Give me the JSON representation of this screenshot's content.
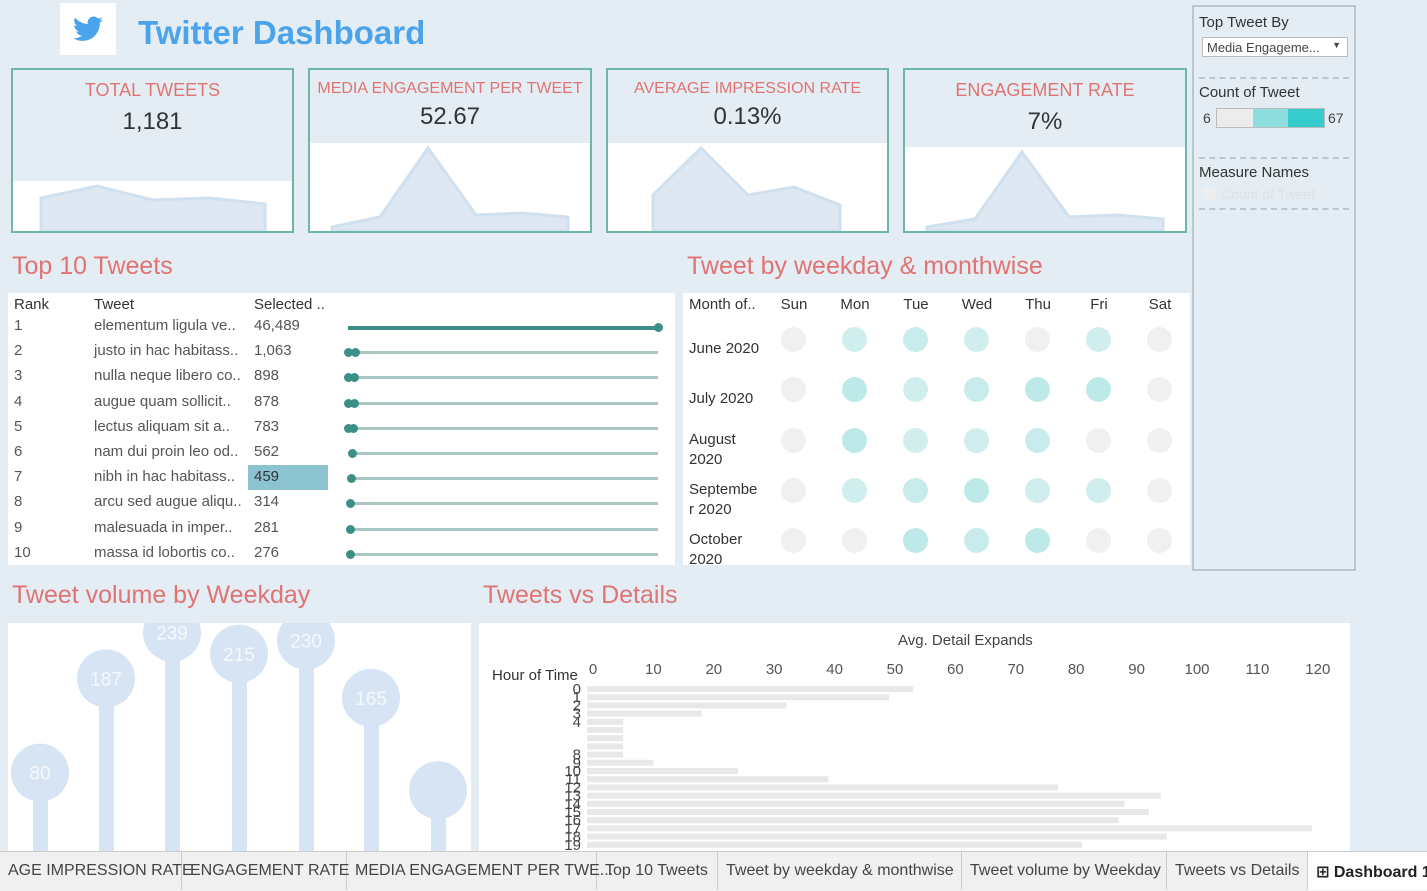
{
  "header": {
    "title": "Twitter Dashboard",
    "logo_icon": "twitter-bird-icon"
  },
  "kpis": [
    {
      "label": "TOTAL TWEETS",
      "value": "1,181"
    },
    {
      "label": "MEDIA ENGAGEMENT PER TWEET",
      "value": "52.67"
    },
    {
      "label": "AVERAGE IMPRESSION RATE",
      "value": "0.13%"
    },
    {
      "label": "ENGAGEMENT RATE",
      "value": "7%"
    }
  ],
  "top10": {
    "title": "Top 10 Tweets",
    "headers": [
      "Rank",
      "Tweet",
      "Selected .."
    ],
    "rows": [
      {
        "rank": "1",
        "tweet": "elementum ligula ve..",
        "value": "46,489",
        "frac": 1.0
      },
      {
        "rank": "2",
        "tweet": "justo in hac habitass..",
        "value": "1,063",
        "frac": 0.023
      },
      {
        "rank": "3",
        "tweet": "nulla neque libero co..",
        "value": "898",
        "frac": 0.019
      },
      {
        "rank": "4",
        "tweet": "augue quam sollicit..",
        "value": "878",
        "frac": 0.019
      },
      {
        "rank": "5",
        "tweet": "lectus aliquam sit a..",
        "value": "783",
        "frac": 0.017
      },
      {
        "rank": "6",
        "tweet": "nam dui proin leo od..",
        "value": "562",
        "frac": 0.012
      },
      {
        "rank": "7",
        "tweet": "nibh in hac habitass..",
        "value": "459",
        "frac": 0.01,
        "selected": true
      },
      {
        "rank": "8",
        "tweet": "arcu sed augue aliqu..",
        "value": "314",
        "frac": 0.007
      },
      {
        "rank": "9",
        "tweet": "malesuada in imper..",
        "value": "281",
        "frac": 0.006
      },
      {
        "rank": "10",
        "tweet": "massa id lobortis co..",
        "value": "276",
        "frac": 0.006
      }
    ]
  },
  "weekday_month": {
    "title": "Tweet by weekday & monthwise",
    "row_header": "Month of..",
    "days": [
      "Sun",
      "Mon",
      "Tue",
      "Wed",
      "Thu",
      "Fri",
      "Sat"
    ],
    "months": [
      "June 2020",
      "July 2020",
      "August 2020",
      "September 2020",
      "October 2020"
    ],
    "month_display": [
      "June 2020",
      "July 2020",
      "August\n2020",
      "Septembe\nr 2020",
      "October\n2020"
    ],
    "intensity": [
      [
        0,
        2,
        3,
        2,
        0,
        2,
        0
      ],
      [
        0,
        4,
        2,
        3,
        4,
        4,
        0
      ],
      [
        0,
        4,
        2,
        2,
        3,
        0,
        0
      ],
      [
        0,
        2,
        3,
        4,
        2,
        2,
        0
      ],
      [
        0,
        0,
        4,
        3,
        4,
        0,
        0
      ]
    ],
    "colors": [
      "#f0f0f0",
      "#dcf0f0",
      "#d1eeee",
      "#c8ecec",
      "#bde9e9"
    ]
  },
  "right_panel": {
    "top_tweet_label": "Top Tweet By",
    "top_tweet_value": "Media Engageme...",
    "count_label": "Count of Tweet",
    "count_min": "6",
    "count_max": "67",
    "measure_label": "Measure Names",
    "measure_item": "Count of Tweet"
  },
  "volume": {
    "title": "Tweet volume by Weekday",
    "values": [
      80,
      187,
      239,
      215,
      230,
      165,
      null
    ]
  },
  "details": {
    "title": "Tweets vs Details",
    "x_title": "Avg. Detail Expands",
    "y_title": "Hour of Time",
    "ticks": [
      "0",
      "10",
      "20",
      "30",
      "40",
      "50",
      "60",
      "70",
      "80",
      "90",
      "100",
      "110",
      "120"
    ]
  },
  "chart_data": [
    {
      "type": "bar",
      "title": "Tweets vs Details",
      "xlabel": "Avg. Detail Expands",
      "ylabel": "Hour of Time",
      "xlim": [
        0,
        125
      ],
      "categories": [
        "0",
        "1",
        "2",
        "3",
        "4",
        "8",
        "9",
        "10",
        "11",
        "12",
        "13",
        "14",
        "15",
        "16",
        "17",
        "18",
        "19"
      ],
      "values": [
        54,
        50,
        33,
        19,
        6,
        6,
        11,
        25,
        40,
        78,
        95,
        89,
        93,
        88,
        120,
        96,
        82
      ]
    },
    {
      "type": "bar",
      "title": "Tweet volume by Weekday",
      "categories": [
        "Sun",
        "Mon",
        "Tue",
        "Wed",
        "Thu",
        "Fri"
      ],
      "values": [
        80,
        187,
        239,
        215,
        230,
        165
      ]
    }
  ],
  "tabs": [
    "AGE IMPRESSION RATE",
    "ENGAGEMENT RATE",
    "MEDIA ENGAGEMENT PER TWE...",
    "Top 10 Tweets",
    "Tweet by weekday & monthwise",
    "Tweet volume by Weekday",
    "Tweets vs Details",
    "Dashboard 1"
  ]
}
